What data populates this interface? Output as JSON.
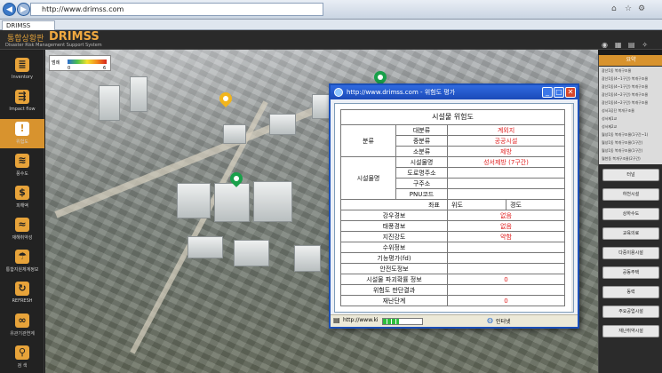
{
  "browser": {
    "address": "http://www.drimss.com",
    "tab_label": "DRIMSS"
  },
  "app": {
    "logo_korean": "통합상황판",
    "logo_english": "DRIMSS",
    "logo_subtitle": "Disaster Risk Management Support System"
  },
  "sidebar": {
    "items": [
      {
        "label": "Inventory",
        "icon": "inventory-icon"
      },
      {
        "label": "Impact flow",
        "icon": "impact-flow-icon"
      },
      {
        "label": "위험도",
        "icon": "warning-icon"
      },
      {
        "label": "풍수도",
        "icon": "flood-icon"
      },
      {
        "label": "피해액",
        "icon": "damage-cost-icon"
      },
      {
        "label": "재해취약성",
        "icon": "vulnerability-icon"
      },
      {
        "label": "통합지원체계정보",
        "icon": "support-icon"
      },
      {
        "label": "REFRESH",
        "icon": "refresh-icon"
      },
      {
        "label": "유관기관연계",
        "icon": "link-icon"
      },
      {
        "label": "검 색",
        "icon": "search-icon"
      }
    ]
  },
  "legend": {
    "title": "범례",
    "low": "0",
    "high": "6"
  },
  "right_panel": {
    "header": "요약",
    "list": [
      "광산1동 복개구조물",
      "광산1동(4~1구간) 복개구조물",
      "광산1동(4~1구간) 복개구조물",
      "광산1동(4~2구간) 복개구조물",
      "광산1동(4~2구간) 복개구조물",
      "성서3공단 복개구조물",
      "성서제1교",
      "성서제2교",
      "월성1동 복개구조물(1구간~1)",
      "월성1동 복개구조물(1구간)",
      "월성1동 복개구조물(1구간)",
      "월천동 복개구조물(2구간)"
    ],
    "buttons": [
      "터널",
      "하천시설",
      "상하수도",
      "교육의료",
      "다중이용시설",
      "공동주택",
      "동력",
      "주요공업시설",
      "재난취약시설"
    ]
  },
  "popup": {
    "title": "http://www.drimss.com - 위험도 평가",
    "status_url": "http://www.ki",
    "status_zone": "인터넷",
    "table": {
      "title": "시설물 위험도",
      "group_class": "분류",
      "group_facility": "시설물명",
      "rows_class": [
        {
          "label": "대분류",
          "value": "계외지"
        },
        {
          "label": "중분류",
          "value": "공공시설"
        },
        {
          "label": "소분류",
          "value": "제방"
        }
      ],
      "rows_facility": [
        {
          "label": "시설물명",
          "value": "성서제방 (7구간)"
        },
        {
          "label": "도로명주소",
          "value": ""
        },
        {
          "label": "구주소",
          "value": ""
        },
        {
          "label": "PNU코드",
          "value": ""
        }
      ],
      "coord_label": "좌표",
      "lat_label": "위도",
      "lon_label": "경도",
      "rows_info": [
        {
          "label": "강우경보",
          "value": "없음"
        },
        {
          "label": "태풍경보",
          "value": "없음"
        },
        {
          "label": "지진강도",
          "value": "약함"
        },
        {
          "label": "수위정보",
          "value": ""
        },
        {
          "label": "기능평가(fd)",
          "value": ""
        },
        {
          "label": "안전도정보",
          "value": ""
        },
        {
          "label": "시설물 파괴확률 정보",
          "value": "0"
        },
        {
          "label": "위험도 판단결과",
          "value": ""
        },
        {
          "label": "재난단계",
          "value": "0"
        }
      ]
    }
  },
  "colors": {
    "accent": "#d8932e",
    "value_red": "#e02020",
    "window_blue": "#1b4ab8"
  }
}
